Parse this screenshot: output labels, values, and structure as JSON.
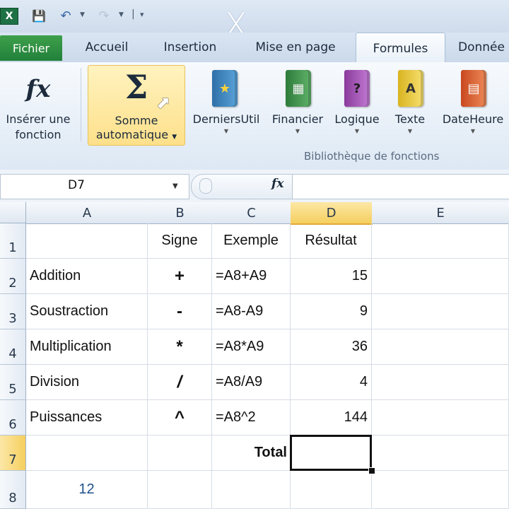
{
  "title_bar": {
    "app_icon": "X",
    "x_mark": "X"
  },
  "tabs": {
    "fichier": "Fichier",
    "accueil": "Accueil",
    "insertion": "Insertion",
    "mise_en_page": "Mise en page",
    "formules": "Formules",
    "donnees": "Donnée"
  },
  "ribbon": {
    "inserer_l1": "Insérer une",
    "inserer_l2": "fonction",
    "fx_glyph": "fx",
    "somme_l1": "Somme",
    "somme_l2": "automatique",
    "sigma": "Σ",
    "derniers": "DerniersUtil",
    "financier": "Financier",
    "logique": "Logique",
    "texte": "Texte",
    "dateheure": "DateHeure",
    "logique_glyph": "?",
    "texte_glyph": "A",
    "group_label": "Bibliothèque de fonctions"
  },
  "formula_bar": {
    "name_box": "D7",
    "fx": "fx",
    "formula": ""
  },
  "columns": [
    "A",
    "B",
    "C",
    "D",
    "E"
  ],
  "rows": [
    {
      "num": "1",
      "a": "",
      "b": "Signe",
      "c": "Exemple",
      "d": "Résultat"
    },
    {
      "num": "2",
      "a": "Addition",
      "b": "+",
      "c": "=A8+A9",
      "d": "15"
    },
    {
      "num": "3",
      "a": "Soustraction",
      "b": "-",
      "c": "=A8-A9",
      "d": "9"
    },
    {
      "num": "4",
      "a": "Multiplication",
      "b": "*",
      "c": "=A8*A9",
      "d": "36"
    },
    {
      "num": "5",
      "a": "Division",
      "b": "/",
      "c": "=A8/A9",
      "d": "4"
    },
    {
      "num": "6",
      "a": "Puissances",
      "b": "^",
      "c": "=A8^2",
      "d": "144"
    },
    {
      "num": "7",
      "a": "",
      "b": "",
      "c": "Total",
      "d": ""
    },
    {
      "num": "8",
      "a": "12",
      "b": "",
      "c": "",
      "d": ""
    }
  ],
  "colors": {
    "accent_green": "#22803a",
    "selected_header": "#f9d56e",
    "value_blue": "#1f4e8c"
  }
}
